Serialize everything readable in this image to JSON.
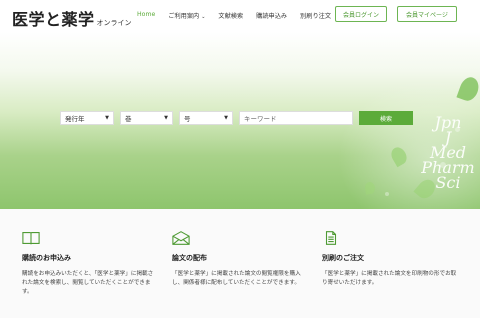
{
  "header": {
    "logo_main": "医学と薬学",
    "logo_sub": "オンライン",
    "nav": [
      {
        "label": "Home",
        "active": true
      },
      {
        "label": "ご利用案内"
      },
      {
        "label": "文献検索"
      },
      {
        "label": "購読申込み"
      },
      {
        "label": "別刷り注文"
      }
    ],
    "login_label": "会員ログイン",
    "mypage_label": "会員マイページ"
  },
  "hero": {
    "title_lines": [
      "Jpn",
      "J",
      "Med",
      "Pharm",
      "Sci"
    ]
  },
  "search": {
    "year_label": "発行年",
    "volume_label": "巻",
    "issue_label": "号",
    "keyword_placeholder": "キーワード",
    "search_button": "検索"
  },
  "cards": [
    {
      "icon": "book-icon",
      "title": "購読のお申込み",
      "text": "購読をお申込みいただくと、「医学と薬学」に掲載された論文を検索し、閲覧していただくことができます。"
    },
    {
      "icon": "envelope-icon",
      "title": "論文の配布",
      "text": "「医学と薬学」に掲載された論文の閲覧権限を購入し、関係者様に配布していただくことができます。"
    },
    {
      "icon": "document-icon",
      "title": "別刷のご注文",
      "text": "「医学と薬学」に掲載された論文を印刷物の形でお取り寄せいただけます。"
    }
  ],
  "colors": {
    "accent": "#5cab3a",
    "accent_border": "#6db552"
  }
}
